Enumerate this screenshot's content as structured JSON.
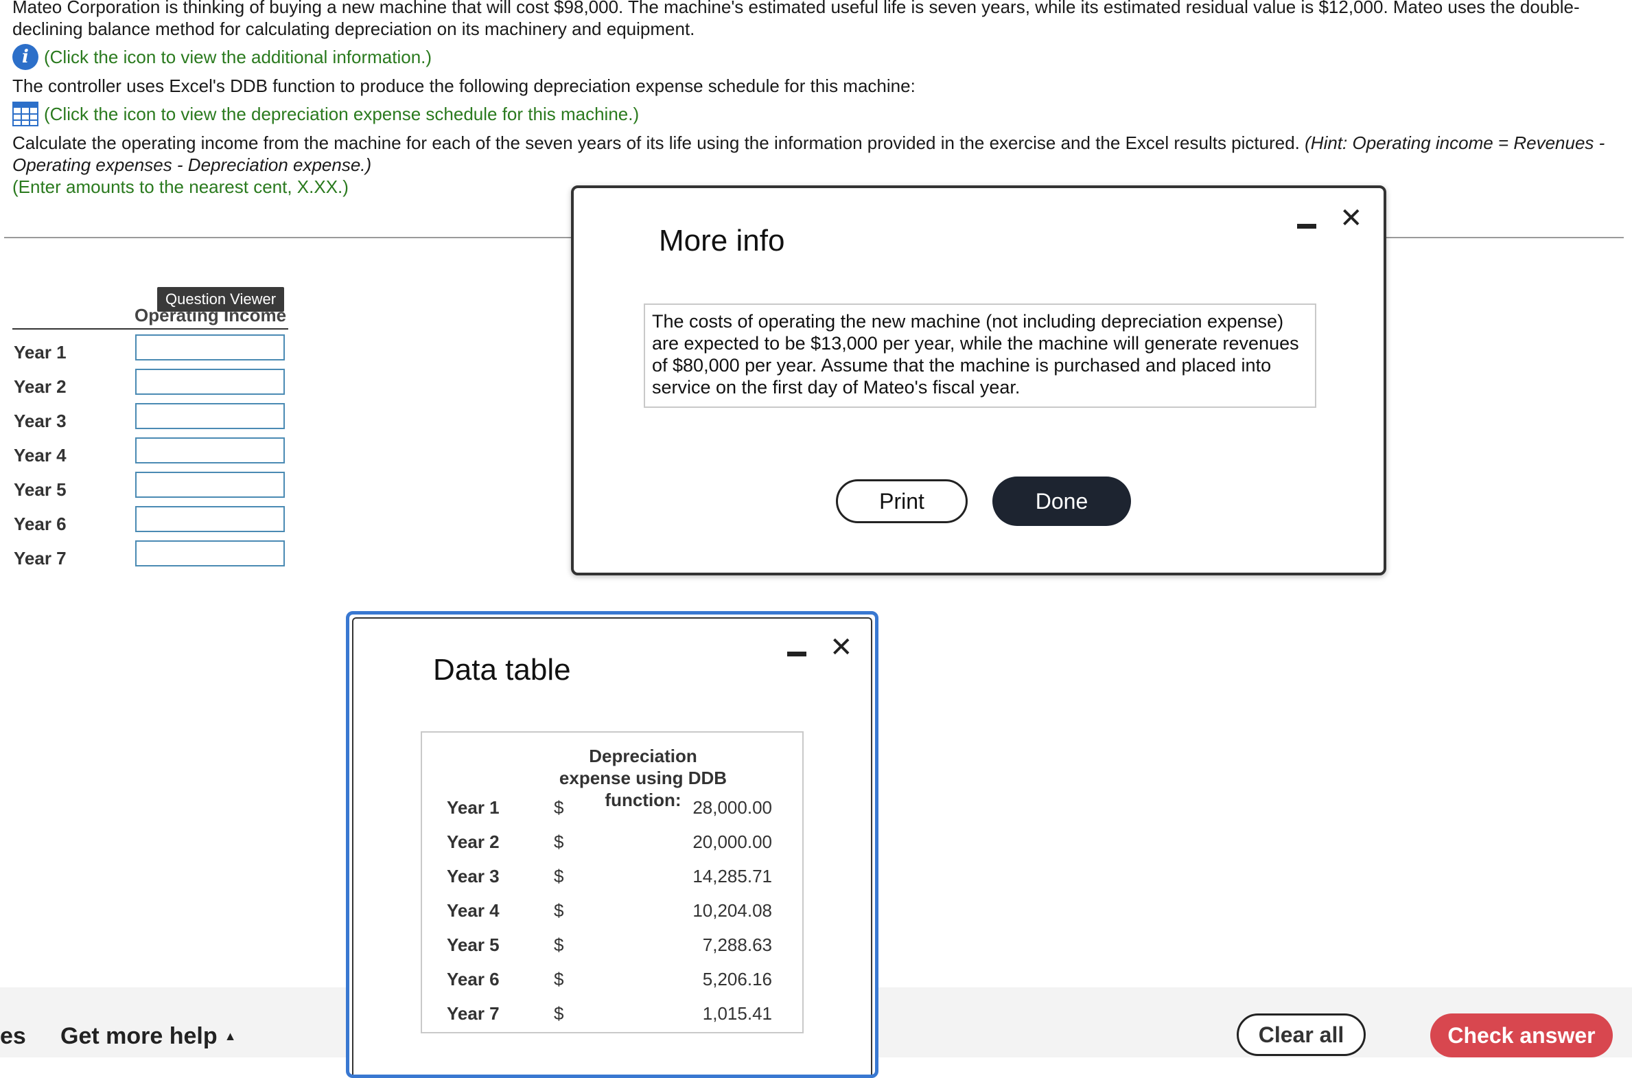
{
  "question": {
    "intro": "Mateo Corporation is thinking of buying a new machine that will cost $98,000. The machine's estimated useful life is seven years, while its estimated residual value is $12,000. Mateo uses the double-declining balance method for calculating depreciation on its machinery and equipment.",
    "info_link": "(Click the icon to view the additional information.)",
    "controller_text": "The controller uses Excel's DDB function to produce the following depreciation expense schedule for this machine:",
    "schedule_link": "(Click the icon to view the depreciation expense schedule for this machine.)",
    "instruction": "Calculate the operating income from the machine for each of the seven years of its life using the information provided in the exercise and the Excel results pictured.",
    "hint": "(Hint: Operating income = Revenues - Operating expenses - Depreciation expense.)",
    "rounding": "(Enter amounts to the nearest cent, X.XX.)"
  },
  "answer_table": {
    "tooltip": "Question Viewer",
    "header": "Operating Income",
    "rows": [
      {
        "label": "Year 1",
        "value": ""
      },
      {
        "label": "Year 2",
        "value": ""
      },
      {
        "label": "Year 3",
        "value": ""
      },
      {
        "label": "Year 4",
        "value": ""
      },
      {
        "label": "Year 5",
        "value": ""
      },
      {
        "label": "Year 6",
        "value": ""
      },
      {
        "label": "Year 7",
        "value": ""
      }
    ]
  },
  "more_info": {
    "title": "More info",
    "text": "The costs of operating the new machine (not including depreciation expense) are expected to be $13,000 per year, while the machine will generate revenues of $80,000 per year. Assume that the machine is purchased and placed into service on the first day of Mateo's fiscal year.",
    "print_label": "Print",
    "done_label": "Done",
    "close_glyph": "✕"
  },
  "data_table": {
    "title": "Data table",
    "header": "Depreciation expense using DDB function:",
    "currency": "$",
    "close_glyph": "✕",
    "rows": [
      {
        "year": "Year 1",
        "value": "28,000.00"
      },
      {
        "year": "Year 2",
        "value": "20,000.00"
      },
      {
        "year": "Year 3",
        "value": "14,285.71"
      },
      {
        "year": "Year 4",
        "value": "10,204.08"
      },
      {
        "year": "Year 5",
        "value": "7,288.63"
      },
      {
        "year": "Year 6",
        "value": "5,206.16"
      },
      {
        "year": "Year 7",
        "value": "1,015.41"
      }
    ]
  },
  "footer": {
    "left_fragment": "es",
    "help_label": "Get more help",
    "help_caret": "▲",
    "clear_label": "Clear all",
    "check_label": "Check answer"
  },
  "colors": {
    "link_green": "#2a7a1e",
    "info_blue": "#2c6fc9",
    "check_red": "#d8474f",
    "done_dark": "#1d2430",
    "modal_blue": "#3978d1"
  }
}
